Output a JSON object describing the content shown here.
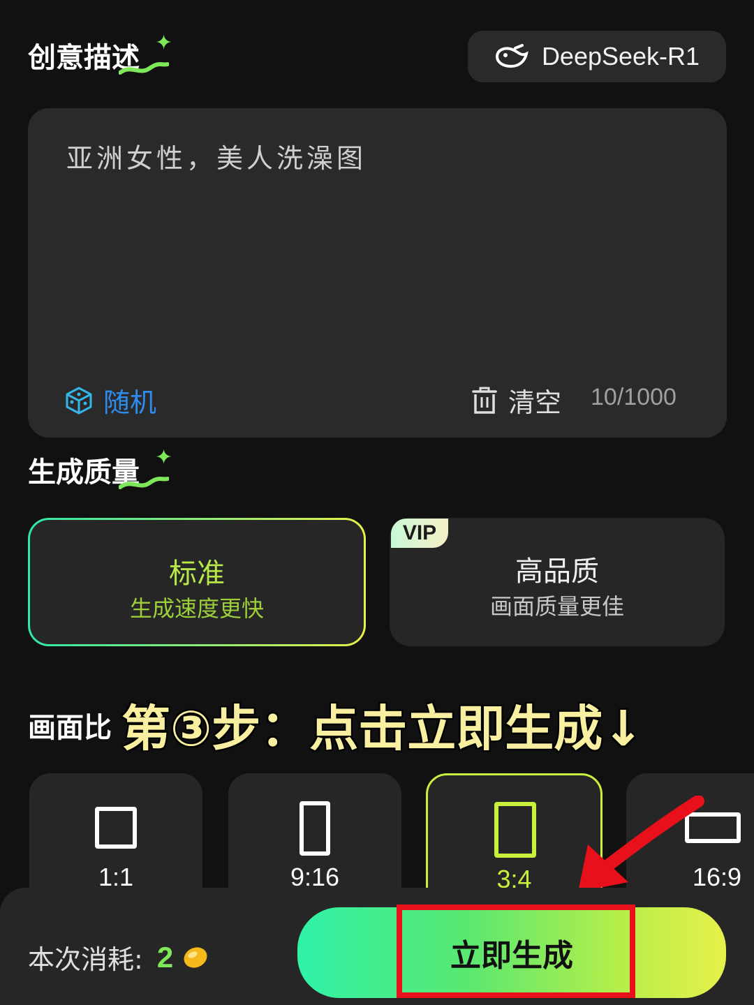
{
  "header": {
    "section_title_description": "创意描述",
    "model_selector_label": "DeepSeek-R1"
  },
  "prompt": {
    "text": "亚洲女性，美人洗澡图",
    "random_label": "随机",
    "clear_label": "清空",
    "char_count": "10/1000"
  },
  "quality": {
    "section_title": "生成质量",
    "options": [
      {
        "name": "标准",
        "desc": "生成速度更快",
        "selected": true
      },
      {
        "name": "高品质",
        "desc": "画面质量更佳",
        "badge": "VIP",
        "selected": false
      }
    ]
  },
  "ratio": {
    "section_title_partial": "画面比",
    "options": [
      {
        "label": "1:1",
        "selected": false
      },
      {
        "label": "9:16",
        "selected": false
      },
      {
        "label": "3:4",
        "selected": true
      },
      {
        "label": "16:9",
        "selected": false
      }
    ]
  },
  "annotation": {
    "text": "第③步：点击立即生成↓"
  },
  "footer": {
    "cost_label": "本次消耗:",
    "cost_value": "2",
    "generate_button": "立即生成"
  },
  "colors": {
    "accent_green": "#7fe85a",
    "accent_lime": "#c9f03a",
    "link_blue": "#2d8cf0",
    "highlight_red": "#e8101a",
    "annotation_yellow": "#f8f0a0"
  },
  "icons": [
    "sparkle-icon",
    "whale-logo-icon",
    "dice-icon",
    "trash-icon",
    "bean-coin-icon",
    "red-arrow"
  ]
}
